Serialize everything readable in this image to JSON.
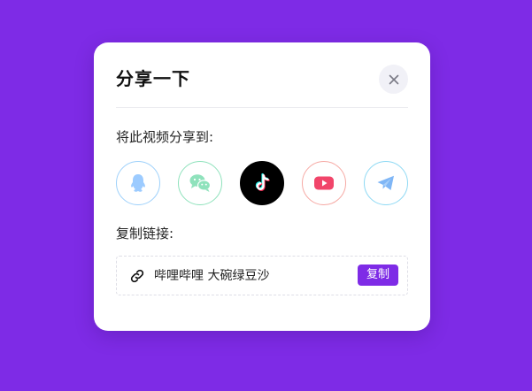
{
  "dialog": {
    "title": "分享一下",
    "share_label": "将此视频分享到:",
    "copy_label": "复制链接:",
    "share_targets": [
      {
        "icon": "qq-icon",
        "border_color": "#9ed1fb"
      },
      {
        "icon": "wechat-icon",
        "border_color": "#8fe2bc"
      },
      {
        "icon": "tiktok-icon",
        "border_color": "#000000"
      },
      {
        "icon": "youtube-icon",
        "border_color": "#f6a9a4"
      },
      {
        "icon": "telegram-icon",
        "border_color": "#8ed9f4"
      }
    ],
    "link": {
      "text": "哔哩哔哩 大碗绿豆沙",
      "copy_button": "复制"
    }
  },
  "colors": {
    "background": "#7e2be6",
    "accent": "#7e2be6"
  }
}
